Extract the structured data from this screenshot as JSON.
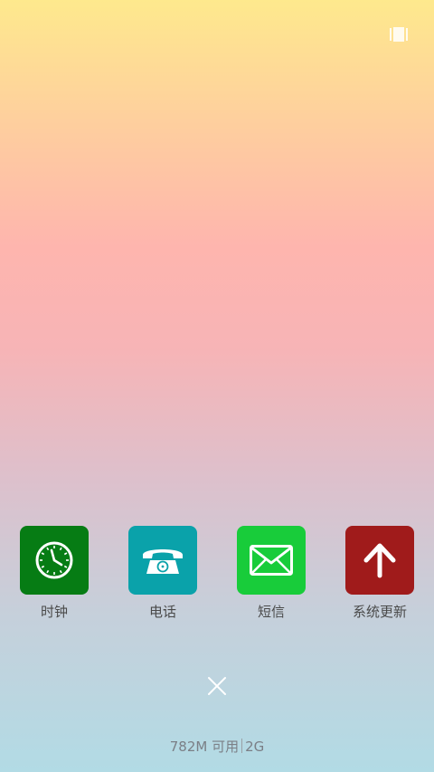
{
  "top_right_icon": "recent-apps-icon",
  "apps": [
    {
      "label": "时钟",
      "icon": "clock-icon",
      "color": "#067c14"
    },
    {
      "label": "电话",
      "icon": "phone-icon",
      "color": "#0aa2aa"
    },
    {
      "label": "短信",
      "icon": "message-icon",
      "color": "#18cc3a"
    },
    {
      "label": "系统更新",
      "icon": "update-arrow-icon",
      "color": "#a01b1b"
    }
  ],
  "close_icon": "close-icon",
  "memory": {
    "available": "782M 可用",
    "total": "2G"
  }
}
